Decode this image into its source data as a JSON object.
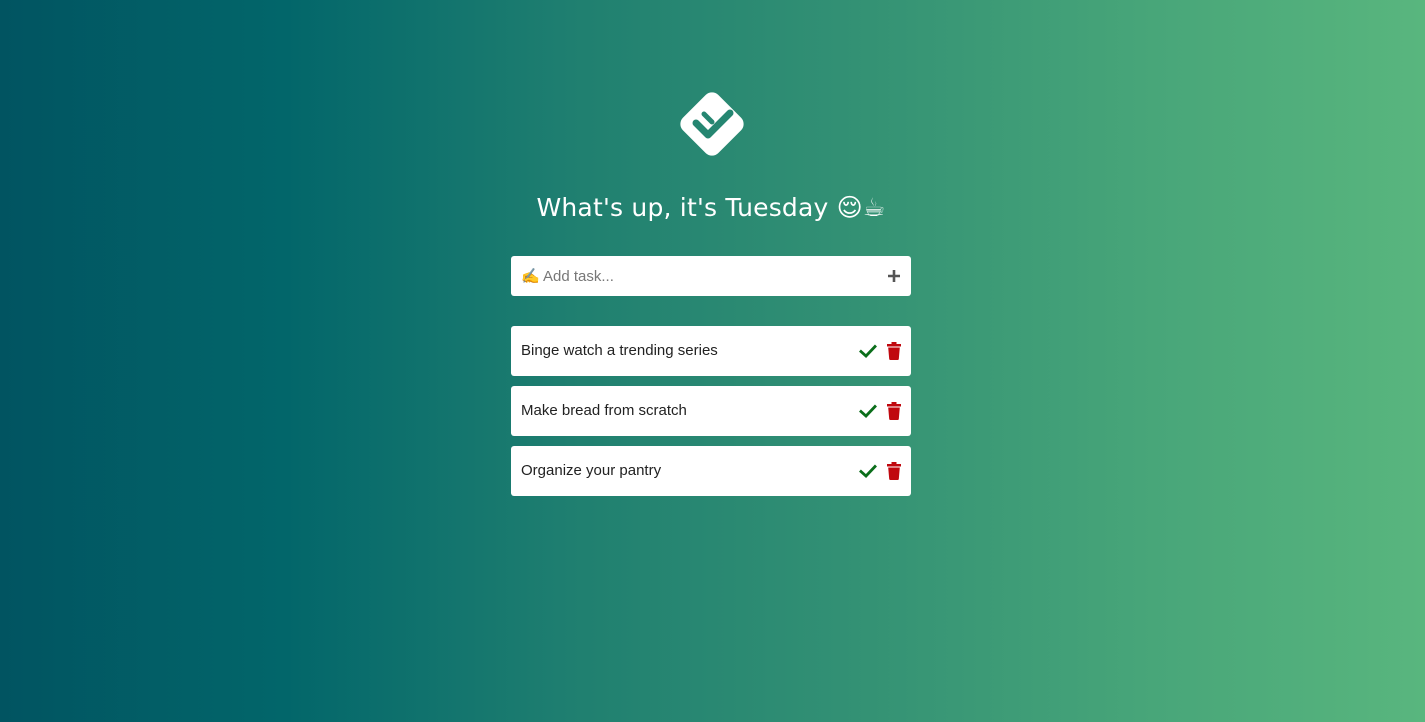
{
  "header": {
    "logo_icon": "double-check-logo-icon",
    "greeting": "What's up, it's Tuesday 😌☕"
  },
  "add_task": {
    "placeholder": "✍ Add task...",
    "value": "",
    "add_icon": "plus-icon"
  },
  "tasks": [
    {
      "text": "Binge watch a trending series",
      "done_icon": "check-icon",
      "delete_icon": "trash-icon"
    },
    {
      "text": "Make bread from scratch",
      "done_icon": "check-icon",
      "delete_icon": "trash-icon"
    },
    {
      "text": "Organize your pantry",
      "done_icon": "check-icon",
      "delete_icon": "trash-icon"
    }
  ],
  "colors": {
    "background_start": "#015461",
    "background_end": "#59b67e",
    "check": "#0b6e1b",
    "delete": "#c0080f",
    "logo": "#ffffff"
  }
}
